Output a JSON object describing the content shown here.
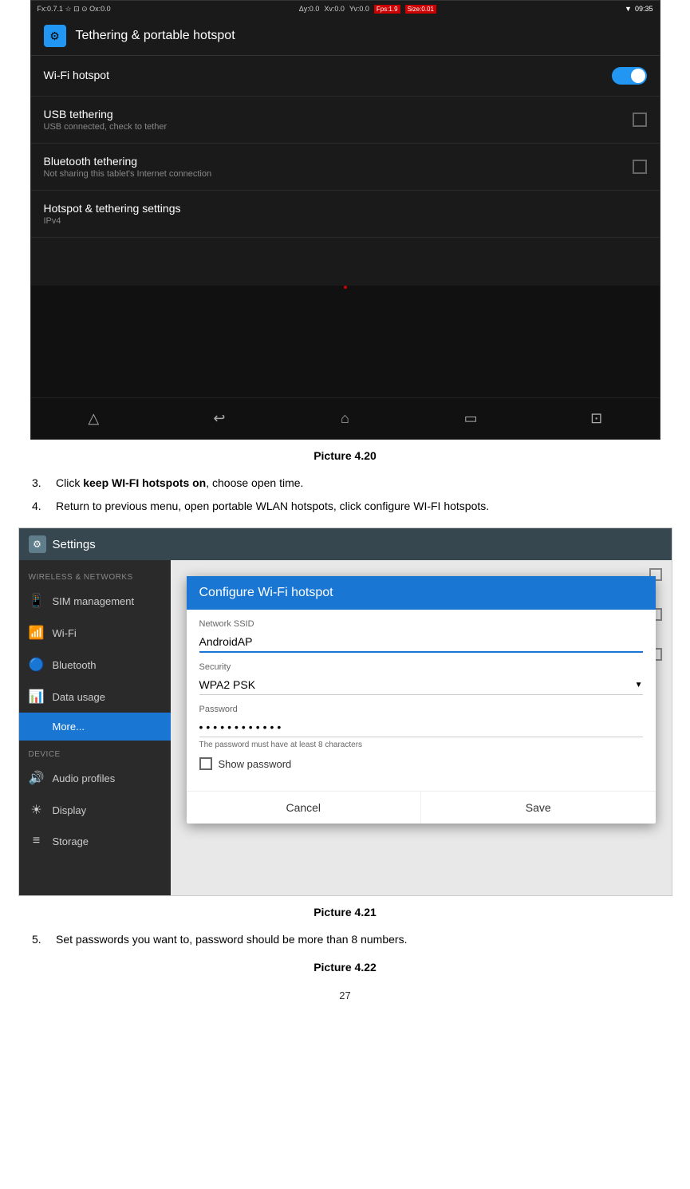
{
  "screen1": {
    "statusBar": {
      "left": "Fx:0.7.1  ☆  ⊡  ⊙  Ox:0.0",
      "middle1": "Δy:0.0",
      "middle2": "Xv:0.0",
      "middle3": "Yv:0.0",
      "fps": "Fps:1.9",
      "size": "Size:0.01",
      "time": "09:35"
    },
    "header": {
      "title": "Tethering & portable hotspot"
    },
    "items": [
      {
        "title": "Wi-Fi hotspot",
        "subtitle": "",
        "control": "toggle-on"
      },
      {
        "title": "USB tethering",
        "subtitle": "USB connected, check to tether",
        "control": "checkbox"
      },
      {
        "title": "Bluetooth tethering",
        "subtitle": "Not sharing this tablet's Internet connection",
        "control": "checkbox"
      },
      {
        "title": "Hotspot & tethering settings",
        "subtitle": "IPv4",
        "control": "none"
      }
    ]
  },
  "caption1": "Picture 4.20",
  "instructions": [
    {
      "num": "3.",
      "text": "Click ",
      "bold": "keep WI-FI hotspots on",
      "rest": ", choose open time."
    },
    {
      "num": "4.",
      "text": "Return to previous menu, open portable WLAN hotspots, click configure WI-FI hotspots."
    }
  ],
  "caption2": "Picture 4.21",
  "screen2": {
    "appTitle": "Settings",
    "sidebar": {
      "wirelessLabel": "WIRELESS & NETWORKS",
      "items": [
        {
          "icon": "📱",
          "label": "SIM management"
        },
        {
          "icon": "📶",
          "label": "Wi-Fi"
        },
        {
          "icon": "🔵",
          "label": "Bluetooth"
        },
        {
          "icon": "📊",
          "label": "Data usage"
        },
        {
          "icon": "",
          "label": "More..."
        }
      ],
      "deviceLabel": "DEVICE",
      "deviceItems": [
        {
          "icon": "🔊",
          "label": "Audio profiles"
        },
        {
          "icon": "☀",
          "label": "Display"
        },
        {
          "icon": "≡",
          "label": "Storage"
        }
      ]
    },
    "dialog": {
      "title": "Configure Wi-Fi hotspot",
      "networkSSIDLabel": "Network SSID",
      "networkSSIDValue": "AndroidAP",
      "securityLabel": "Security",
      "securityValue": "WPA2 PSK",
      "passwordLabel": "Password",
      "passwordValue": "••••••••••••",
      "hint": "The password must have at least 8 characters",
      "showPasswordLabel": "Show password",
      "cancelBtn": "Cancel",
      "saveBtn": "Save"
    }
  },
  "instruction5": {
    "num": "5.",
    "text": "Set passwords you want to, password should be more than 8 numbers."
  },
  "caption3": "Picture 4.22",
  "pageNumber": "27"
}
